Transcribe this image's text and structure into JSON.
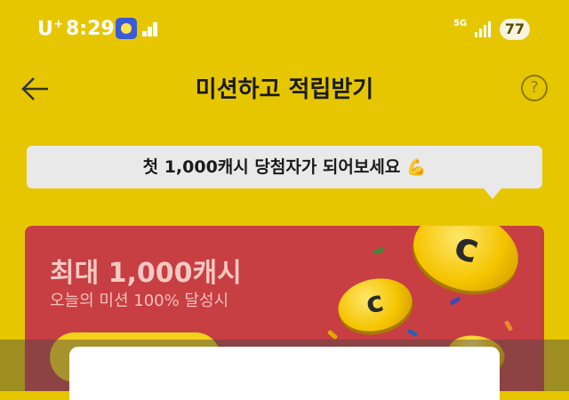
{
  "status_bar": {
    "carrier": "U",
    "carrier_sup": "+",
    "time": "8:29",
    "network": "5G",
    "battery": "77"
  },
  "header": {
    "title": "미션하고 적립받기",
    "help_glyph": "?"
  },
  "tooltip": {
    "text": "첫 1,000캐시 당첨자가 되어보세요",
    "emoji": "💪"
  },
  "banner": {
    "title": "최대 1,000캐시",
    "subtitle": "오늘의 미션 100% 달성시"
  },
  "icons": {
    "back": "arrow-left-icon",
    "help": "question-circle-icon",
    "coin": "coin-icon"
  },
  "colors": {
    "background": "#e6c600",
    "banner": "#c73e43",
    "coin": "#f5c400",
    "tooltip": "#e9e9e9"
  }
}
